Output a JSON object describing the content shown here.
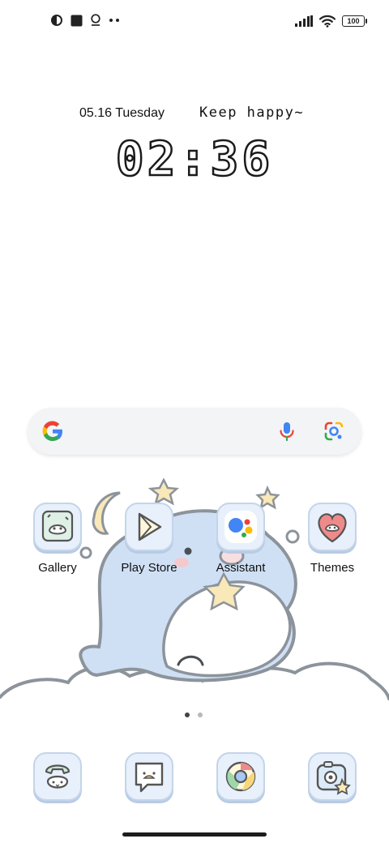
{
  "status_bar": {
    "battery": "100",
    "icons": [
      "circle-half-icon",
      "square-icon",
      "location-pin-icon",
      "more-dots-icon",
      "signal-icon",
      "wifi-icon",
      "battery-icon"
    ]
  },
  "clock_widget": {
    "date": "05.16 Tuesday",
    "motto": "Keep happy~",
    "time": "02:36"
  },
  "search_bar": {
    "icons": [
      "google-logo-icon",
      "microphone-icon",
      "google-lens-icon"
    ]
  },
  "apps": [
    {
      "label": "Gallery",
      "icon": "gallery-icon"
    },
    {
      "label": "Play Store",
      "icon": "play-store-icon"
    },
    {
      "label": "Assistant",
      "icon": "assistant-icon"
    },
    {
      "label": "Themes",
      "icon": "themes-heart-icon"
    }
  ],
  "page_indicator": {
    "count": 2,
    "active": 1
  },
  "dock": [
    {
      "icon": "phone-icon"
    },
    {
      "icon": "messages-icon"
    },
    {
      "icon": "chrome-icon"
    },
    {
      "icon": "camera-icon"
    }
  ],
  "colors": {
    "icon_bg": "#e7f0fb",
    "icon_border": "#c4d5ea",
    "wallpaper_fish": "#cfe0f5",
    "star": "#f9e8b8"
  }
}
